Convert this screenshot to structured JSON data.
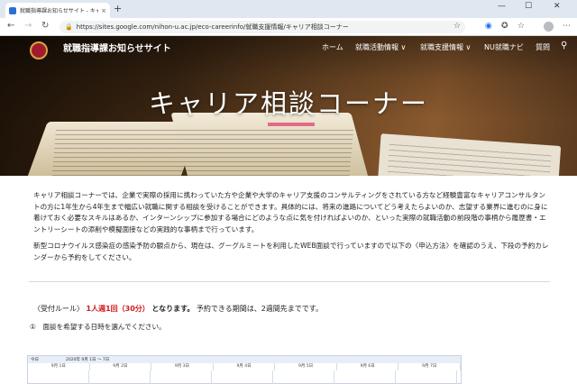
{
  "browser": {
    "tab_title": "就職指導課お知らせサイト - キャリア",
    "tab_close": "×",
    "new_tab": "+",
    "url": "https://sites.google.com/nihon-u.ac.jp/eco-careerinfo/就職支援情報/キャリア相談コーナー",
    "minimize": "—",
    "maximize": "☐",
    "close": "✕",
    "back": "←",
    "forward": "→",
    "reload": "↻",
    "lock": "🔒",
    "star": "☆",
    "menu": "⋯"
  },
  "site": {
    "title": "就職指導課お知らせサイト",
    "nav": [
      "ホーム",
      "就職活動情報 ∨",
      "就職支援情報 ∨",
      "NU就職ナビ",
      "質問"
    ],
    "search_icon": "⚲"
  },
  "hero": {
    "title": "キャリア相談コーナー",
    "accent_color": "#e36a8a"
  },
  "content": {
    "intro": "キャリア相談コーナーでは、企業で実際の採用に携わっていた方や企業や大学のキャリア支援のコンサルティングをされている方など経験豊富なキャリアコンサルタントの方に1年生から4年生まで幅広い就職に関する相談を受けることができます。具体的には、将来の進路についてどう考えたらよいのか、志望する業界に進むのに身に着けておく必要なスキルはあるか、インターンシップに参加する場合にどのような点に気を付ければよいのか、といった実際の就職活動の前段階の事柄から履歴書・エントリーシートの添削や模擬面接などの実践的な事柄まで行っています。",
    "notice": "新型コロナウイルス感染症の感染予防の観点から、現在は、グーグルミートを利用したWEB面談で行っていますので以下の〈申込方法〉を確認のうえ、下段の予約カレンダーから予約をしてください。",
    "rule_label": "〈受付ルール〉",
    "rule_highlight": "1人週1回（30分）",
    "rule_bold": "となります。",
    "rule_rest": "予約できる期間は、2週間先までです。",
    "step1": "①　面談を希望する日時を選んでください。"
  },
  "calendar": {
    "today": "今日",
    "range": "2020年 9月 1日 ～ 7日",
    "days": [
      "9月 1日",
      "9月 2日",
      "9月 3日",
      "9月 4日",
      "9月 5日",
      "9月 6日",
      "9月 7日"
    ]
  }
}
